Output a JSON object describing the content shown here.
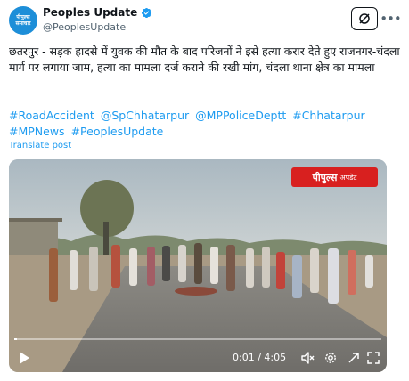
{
  "account": {
    "avatar_line1": "पीपुल्स",
    "avatar_line2": "समाचार",
    "display_name": "Peoples Update",
    "handle": "@PeoplesUpdate",
    "verified": true
  },
  "tweet": {
    "text": "छतरपुर - सड़क हादसे में युवक की मौत के बाद परिजनों ने इसे हत्या करार देते हुए राजनगर-चंदला मार्ग पर लगाया जाम, हत्या का मामला दर्ज कराने की रखी मांग, चंदला थाना क्षेत्र का मामला",
    "hashtags": [
      "#RoadAccident",
      "@SpChhatarpur",
      "@MPPoliceDeptt",
      "#Chhatarpur",
      "#MPNews",
      "#PeoplesUpdate"
    ],
    "translate_label": "Translate post"
  },
  "video": {
    "watermark_main": "पीपुल्स",
    "watermark_sub": "अपडेट",
    "time_display": "0:01 / 4:05",
    "progress_fraction": 0.004
  },
  "icons": {
    "grok": "grok-icon",
    "more": "more-icon",
    "play": "play-icon",
    "volume": "volume-icon",
    "settings": "settings-icon",
    "fullscreen": "fullscreen-icon"
  },
  "colors": {
    "link": "#1d9bf0",
    "verified": "#1d9bf0",
    "watermark": "#d8201f",
    "avatar": "#1d8ed8"
  }
}
